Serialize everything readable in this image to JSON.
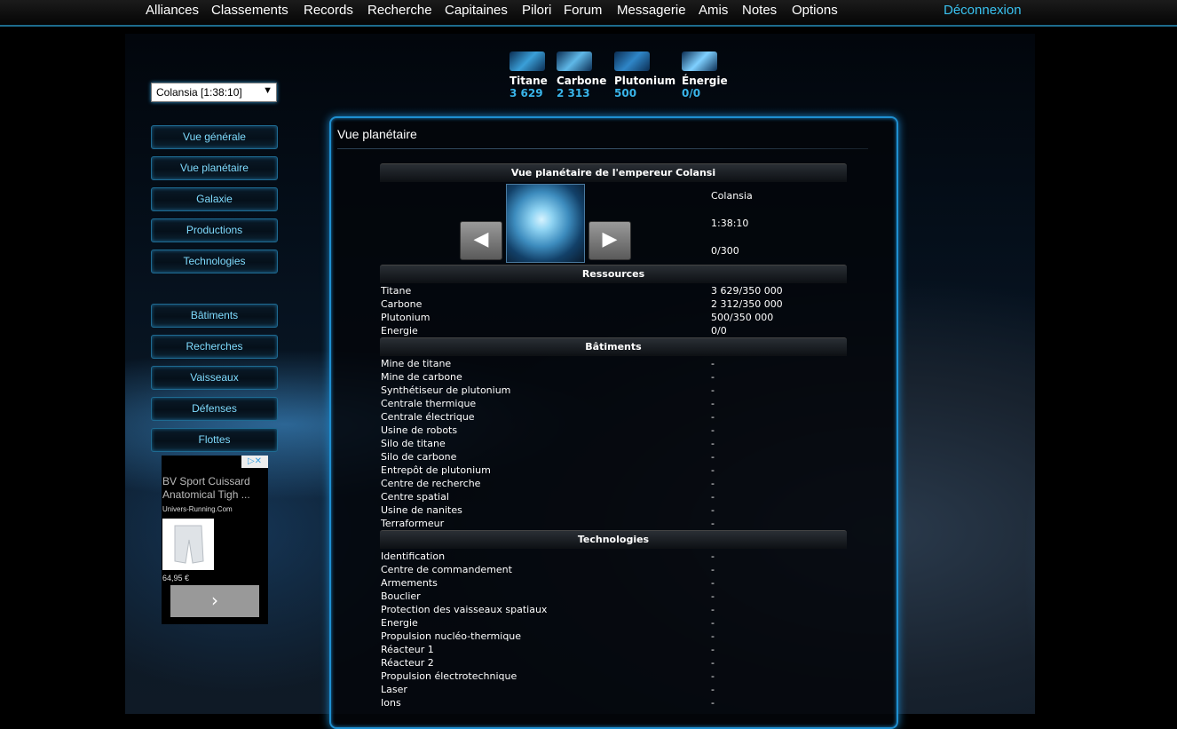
{
  "nav": {
    "items": [
      "Alliances",
      "Classements",
      "Records",
      "Recherche",
      "Capitaines",
      "Pilori",
      "Forum",
      "Messagerie",
      "Amis",
      "Notes",
      "Options"
    ],
    "logout": "Déconnexion"
  },
  "planet_select": {
    "value": "Colansia [1:38:10]"
  },
  "sidebar": {
    "group1": [
      "Vue générale",
      "Vue planétaire",
      "Galaxie",
      "Productions",
      "Technologies"
    ],
    "group2": [
      "Bâtiments",
      "Recherches",
      "Vaisseaux",
      "Défenses",
      "Flottes"
    ]
  },
  "ad": {
    "title": "BV Sport Cuissard Anatomical Tigh ...",
    "domain": "Univers-Running.Com",
    "price": "64,95 €"
  },
  "resources": [
    {
      "name": "Titane",
      "value": "3 629",
      "color": "#3a9fd8"
    },
    {
      "name": "Carbone",
      "value": "2 313",
      "color": "#5fb8e8"
    },
    {
      "name": "Plutonium",
      "value": "500",
      "color": "#2f86c8"
    },
    {
      "name": "Énergie",
      "value": "0/0",
      "color": "#7fd0ff"
    }
  ],
  "panel": {
    "title": "Vue planétaire",
    "heading": "Vue planétaire de l'empereur Colansi",
    "planet": {
      "name": "Colansia",
      "coords": "1:38:10",
      "fields": "0/300"
    },
    "sections": {
      "ressources": "Ressources",
      "batiments": "Bâtiments",
      "technologies": "Technologies"
    },
    "ressources": [
      [
        "Titane",
        "3 629/350 000"
      ],
      [
        "Carbone",
        "2 312/350 000"
      ],
      [
        "Plutonium",
        "500/350 000"
      ],
      [
        "Energie",
        "0/0"
      ]
    ],
    "batiments": [
      [
        "Mine de titane",
        "-"
      ],
      [
        "Mine de carbone",
        "-"
      ],
      [
        "Synthétiseur de plutonium",
        "-"
      ],
      [
        "Centrale thermique",
        "-"
      ],
      [
        "Centrale électrique",
        "-"
      ],
      [
        "Usine de robots",
        "-"
      ],
      [
        "Silo de titane",
        "-"
      ],
      [
        "Silo de carbone",
        "-"
      ],
      [
        "Entrepôt de plutonium",
        "-"
      ],
      [
        "Centre de recherche",
        "-"
      ],
      [
        "Centre spatial",
        "-"
      ],
      [
        "Usine de nanites",
        "-"
      ],
      [
        "Terraformeur",
        "-"
      ]
    ],
    "technologies": [
      [
        "Identification",
        "-"
      ],
      [
        "Centre de commandement",
        "-"
      ],
      [
        "Armements",
        "-"
      ],
      [
        "Bouclier",
        "-"
      ],
      [
        "Protection des vaisseaux spatiaux",
        "-"
      ],
      [
        "Energie",
        "-"
      ],
      [
        "Propulsion nucléo-thermique",
        "-"
      ],
      [
        "Réacteur 1",
        "-"
      ],
      [
        "Réacteur 2",
        "-"
      ],
      [
        "Propulsion électrotechnique",
        "-"
      ],
      [
        "Laser",
        "-"
      ],
      [
        "Ions",
        "-"
      ]
    ]
  }
}
